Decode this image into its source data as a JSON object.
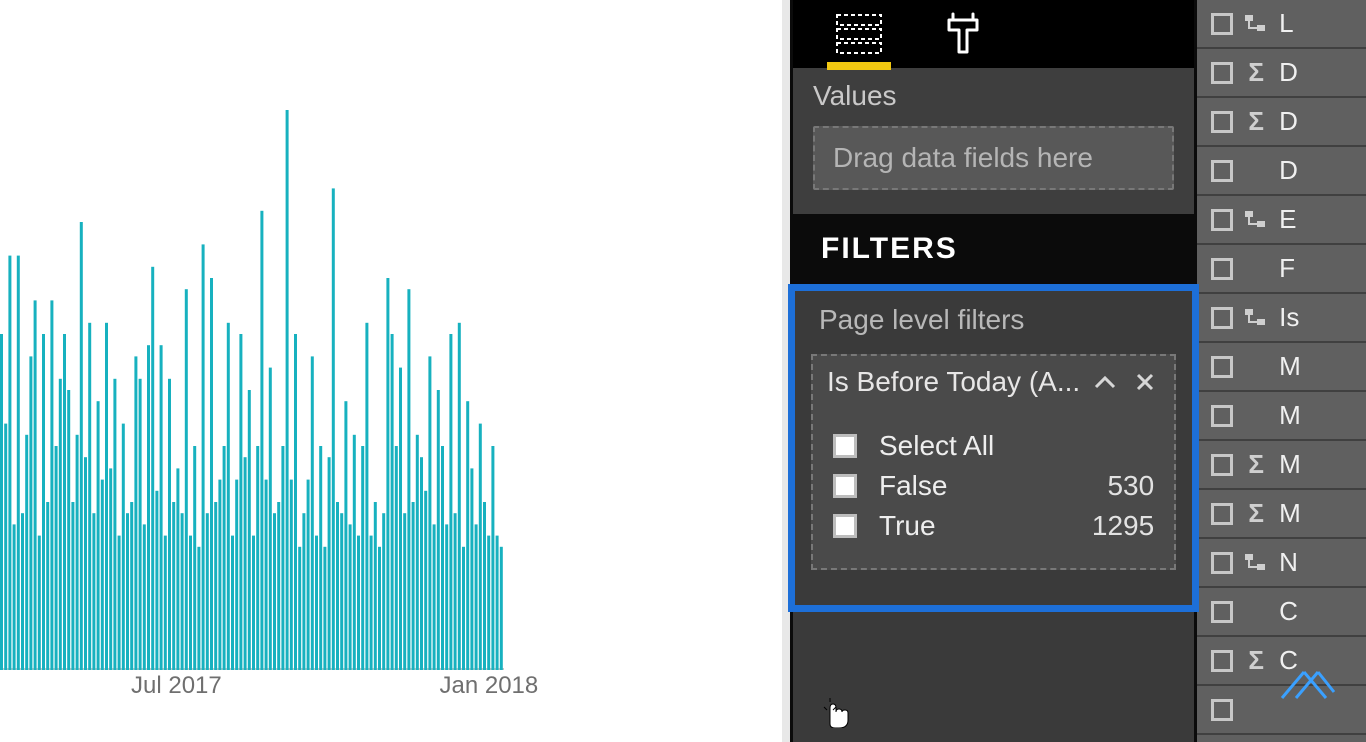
{
  "panel": {
    "values_label": "Values",
    "drop_placeholder": "Drag data fields here",
    "filters_header": "FILTERS",
    "page_filters_label": "Page level filters",
    "filter_card": {
      "title": "Is Before Today (A...",
      "options": [
        {
          "label": "Select All",
          "count": ""
        },
        {
          "label": "False",
          "count": "530"
        },
        {
          "label": "True",
          "count": "1295"
        }
      ]
    }
  },
  "fields": [
    {
      "icon": "hier",
      "name": "L"
    },
    {
      "icon": "sigma",
      "name": "D"
    },
    {
      "icon": "sigma",
      "name": "D"
    },
    {
      "icon": "",
      "name": "D"
    },
    {
      "icon": "hier",
      "name": "E"
    },
    {
      "icon": "",
      "name": "F"
    },
    {
      "icon": "hier",
      "name": "Is"
    },
    {
      "icon": "",
      "name": "M"
    },
    {
      "icon": "",
      "name": "M"
    },
    {
      "icon": "sigma",
      "name": "M"
    },
    {
      "icon": "sigma",
      "name": "M"
    },
    {
      "icon": "hier",
      "name": "N"
    },
    {
      "icon": "",
      "name": "C"
    },
    {
      "icon": "sigma",
      "name": "C"
    },
    {
      "icon": "",
      "name": ""
    }
  ],
  "chart_data": {
    "type": "bar",
    "title": "",
    "xlabel": "",
    "ylabel": "",
    "x_ticks": [
      {
        "label": "Jul 2017",
        "pos": 0.35
      },
      {
        "label": "Jan 2018",
        "pos": 0.97
      }
    ],
    "series": [
      {
        "name": "value",
        "color": "#17b1bf",
        "values": [
          60,
          44,
          74,
          26,
          74,
          28,
          42,
          56,
          66,
          24,
          60,
          30,
          66,
          40,
          52,
          60,
          50,
          30,
          42,
          80,
          38,
          62,
          28,
          48,
          34,
          62,
          36,
          52,
          24,
          44,
          28,
          30,
          56,
          52,
          26,
          58,
          72,
          32,
          58,
          24,
          52,
          30,
          36,
          28,
          68,
          24,
          40,
          22,
          76,
          28,
          70,
          30,
          34,
          40,
          62,
          24,
          34,
          60,
          38,
          50,
          24,
          40,
          82,
          34,
          54,
          28,
          30,
          40,
          100,
          34,
          60,
          22,
          28,
          34,
          56,
          24,
          40,
          22,
          38,
          86,
          30,
          28,
          48,
          26,
          42,
          24,
          40,
          62,
          24,
          30,
          22,
          28,
          70,
          60,
          40,
          54,
          28,
          68,
          30,
          42,
          38,
          32,
          56,
          26,
          50,
          40,
          26,
          60,
          28,
          62,
          22,
          48,
          36,
          26,
          44,
          30,
          24,
          40,
          24,
          22
        ]
      }
    ],
    "ylim": [
      0,
      100
    ]
  }
}
